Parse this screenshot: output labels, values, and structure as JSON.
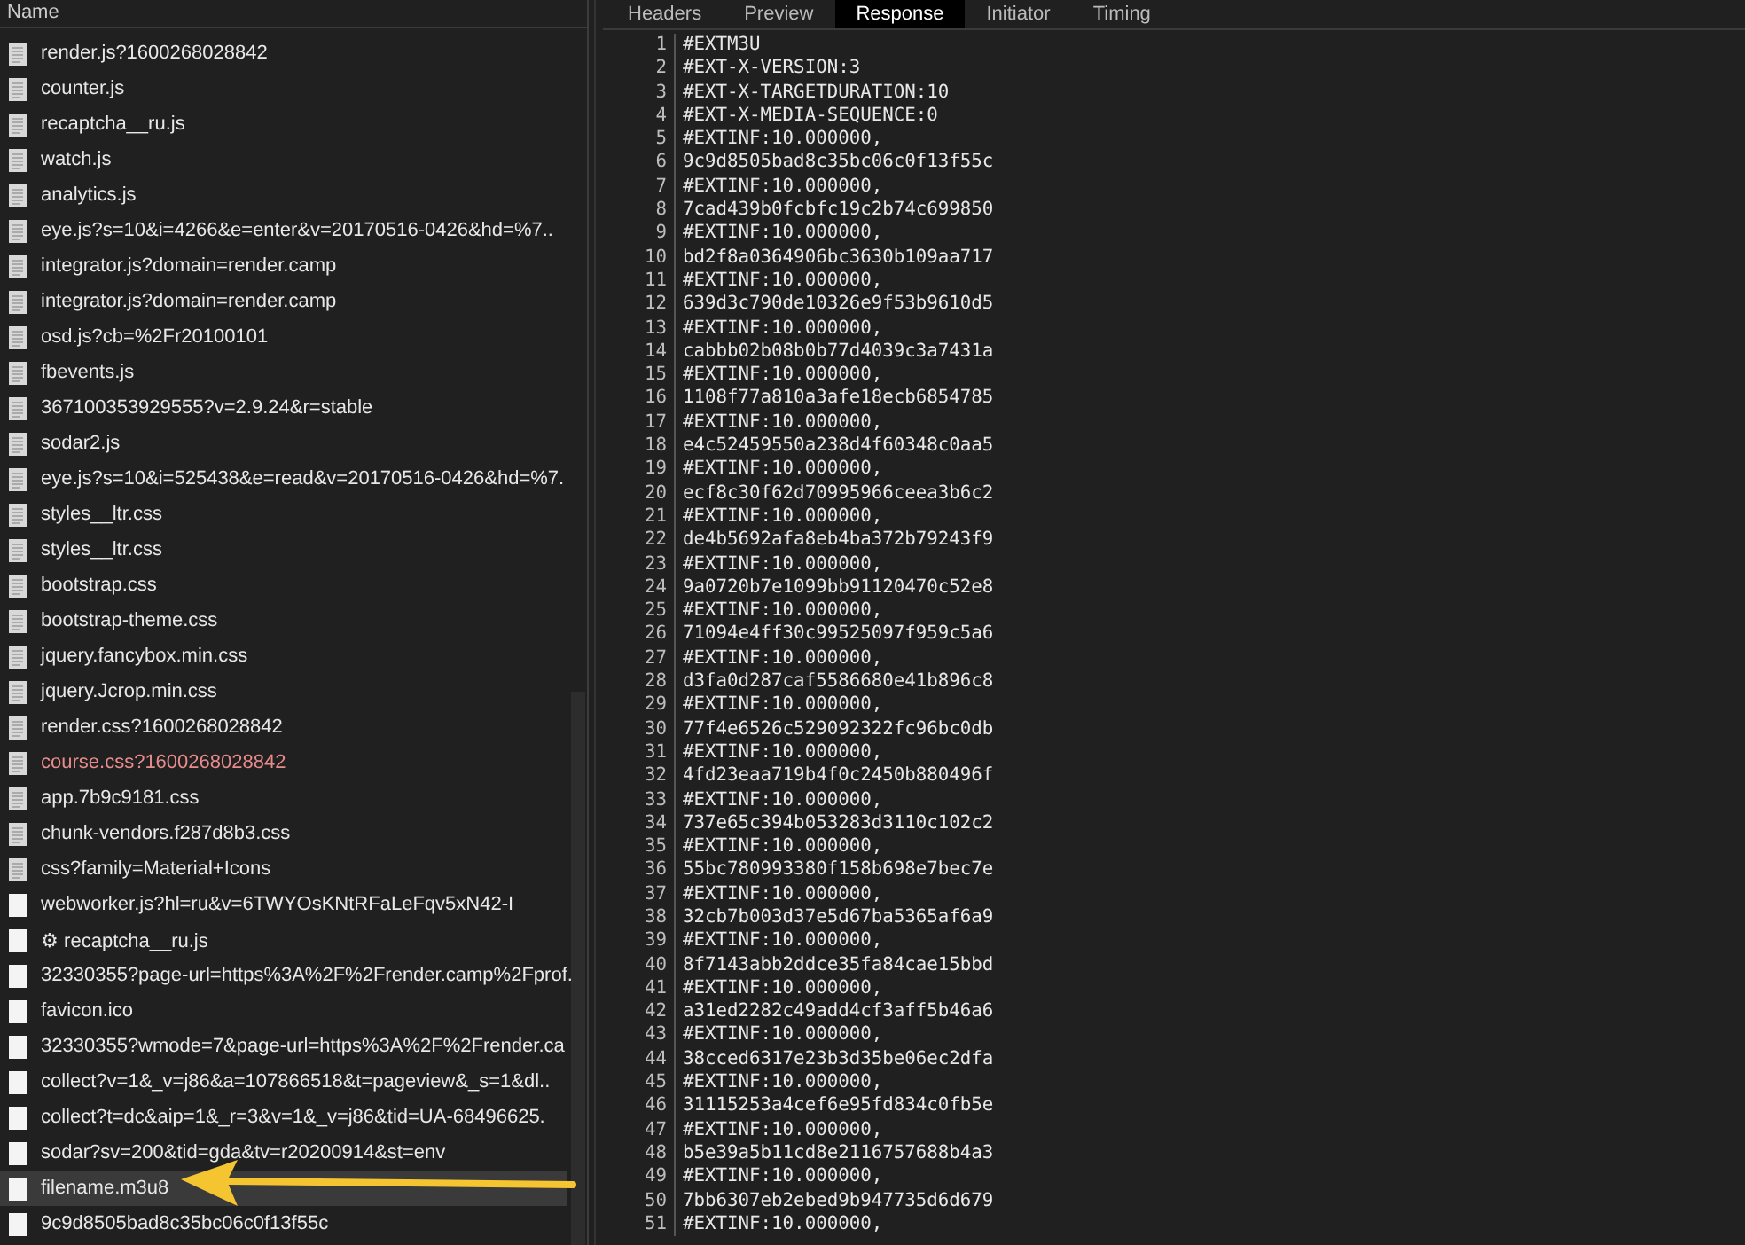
{
  "list_header": {
    "label": "Name"
  },
  "requests": [
    {
      "name": "render.js?1600268028842",
      "kind": "document",
      "error": false,
      "selected": false
    },
    {
      "name": "counter.js",
      "kind": "document",
      "error": false,
      "selected": false
    },
    {
      "name": "recaptcha__ru.js",
      "kind": "document",
      "error": false,
      "selected": false
    },
    {
      "name": "watch.js",
      "kind": "document",
      "error": false,
      "selected": false
    },
    {
      "name": "analytics.js",
      "kind": "document",
      "error": false,
      "selected": false
    },
    {
      "name": "eye.js?s=10&i=4266&e=enter&v=20170516-0426&hd=%7..",
      "kind": "document",
      "error": false,
      "selected": false
    },
    {
      "name": "integrator.js?domain=render.camp",
      "kind": "document",
      "error": false,
      "selected": false
    },
    {
      "name": "integrator.js?domain=render.camp",
      "kind": "document",
      "error": false,
      "selected": false
    },
    {
      "name": "osd.js?cb=%2Fr20100101",
      "kind": "document",
      "error": false,
      "selected": false
    },
    {
      "name": "fbevents.js",
      "kind": "document",
      "error": false,
      "selected": false
    },
    {
      "name": "367100353929555?v=2.9.24&r=stable",
      "kind": "document",
      "error": false,
      "selected": false
    },
    {
      "name": "sodar2.js",
      "kind": "document",
      "error": false,
      "selected": false
    },
    {
      "name": "eye.js?s=10&i=525438&e=read&v=20170516-0426&hd=%7.",
      "kind": "document",
      "error": false,
      "selected": false
    },
    {
      "name": "styles__ltr.css",
      "kind": "document",
      "error": false,
      "selected": false
    },
    {
      "name": "styles__ltr.css",
      "kind": "document",
      "error": false,
      "selected": false
    },
    {
      "name": "bootstrap.css",
      "kind": "document",
      "error": false,
      "selected": false
    },
    {
      "name": "bootstrap-theme.css",
      "kind": "document",
      "error": false,
      "selected": false
    },
    {
      "name": "jquery.fancybox.min.css",
      "kind": "document",
      "error": false,
      "selected": false
    },
    {
      "name": "jquery.Jcrop.min.css",
      "kind": "document",
      "error": false,
      "selected": false
    },
    {
      "name": "render.css?1600268028842",
      "kind": "document",
      "error": false,
      "selected": false
    },
    {
      "name": "course.css?1600268028842",
      "kind": "document",
      "error": true,
      "selected": false
    },
    {
      "name": "app.7b9c9181.css",
      "kind": "document",
      "error": false,
      "selected": false
    },
    {
      "name": "chunk-vendors.f287d8b3.css",
      "kind": "document",
      "error": false,
      "selected": false
    },
    {
      "name": "css?family=Material+Icons",
      "kind": "document",
      "error": false,
      "selected": false
    },
    {
      "name": "webworker.js?hl=ru&v=6TWYOsKNtRFaLeFqv5xN42-I",
      "kind": "blank",
      "error": false,
      "selected": false
    },
    {
      "name": "⚙ recaptcha__ru.js",
      "kind": "blank",
      "error": false,
      "selected": false
    },
    {
      "name": "32330355?page-url=https%3A%2F%2Frender.camp%2Fprof.",
      "kind": "blank",
      "error": false,
      "selected": false
    },
    {
      "name": "favicon.ico",
      "kind": "blank",
      "error": false,
      "selected": false
    },
    {
      "name": "32330355?wmode=7&page-url=https%3A%2F%2Frender.ca",
      "kind": "blank",
      "error": false,
      "selected": false
    },
    {
      "name": "collect?v=1&_v=j86&a=107866518&t=pageview&_s=1&dl..",
      "kind": "blank",
      "error": false,
      "selected": false
    },
    {
      "name": "collect?t=dc&aip=1&_r=3&v=1&_v=j86&tid=UA-68496625.",
      "kind": "blank",
      "error": false,
      "selected": false
    },
    {
      "name": "sodar?sv=200&tid=gda&tv=r20200914&st=env",
      "kind": "blank",
      "error": false,
      "selected": false
    },
    {
      "name": "filename.m3u8",
      "kind": "blank",
      "error": false,
      "selected": true
    },
    {
      "name": "9c9d8505bad8c35bc06c0f13f55c",
      "kind": "blank",
      "error": false,
      "selected": false
    }
  ],
  "tabs": [
    {
      "label": "Headers",
      "selected": false
    },
    {
      "label": "Preview",
      "selected": false
    },
    {
      "label": "Response",
      "selected": true
    },
    {
      "label": "Initiator",
      "selected": false
    },
    {
      "label": "Timing",
      "selected": false
    }
  ],
  "response_lines": [
    {
      "number": "1",
      "text": "#EXTM3U"
    },
    {
      "number": "2",
      "text": "#EXT-X-VERSION:3"
    },
    {
      "number": "3",
      "text": "#EXT-X-TARGETDURATION:10"
    },
    {
      "number": "4",
      "text": "#EXT-X-MEDIA-SEQUENCE:0"
    },
    {
      "number": "5",
      "text": "#EXTINF:10.000000,"
    },
    {
      "number": "6",
      "text": "9c9d8505bad8c35bc06c0f13f55c"
    },
    {
      "number": "7",
      "text": "#EXTINF:10.000000,"
    },
    {
      "number": "8",
      "text": "7cad439b0fcbfc19c2b74c699850"
    },
    {
      "number": "9",
      "text": "#EXTINF:10.000000,"
    },
    {
      "number": "10",
      "text": "bd2f8a0364906bc3630b109aa717"
    },
    {
      "number": "11",
      "text": "#EXTINF:10.000000,"
    },
    {
      "number": "12",
      "text": "639d3c790de10326e9f53b9610d5"
    },
    {
      "number": "13",
      "text": "#EXTINF:10.000000,"
    },
    {
      "number": "14",
      "text": "cabbb02b08b0b77d4039c3a7431a"
    },
    {
      "number": "15",
      "text": "#EXTINF:10.000000,"
    },
    {
      "number": "16",
      "text": "1108f77a810a3afe18ecb6854785"
    },
    {
      "number": "17",
      "text": "#EXTINF:10.000000,"
    },
    {
      "number": "18",
      "text": "e4c52459550a238d4f60348c0aa5"
    },
    {
      "number": "19",
      "text": "#EXTINF:10.000000,"
    },
    {
      "number": "20",
      "text": "ecf8c30f62d70995966ceea3b6c2"
    },
    {
      "number": "21",
      "text": "#EXTINF:10.000000,"
    },
    {
      "number": "22",
      "text": "de4b5692afa8eb4ba372b79243f9"
    },
    {
      "number": "23",
      "text": "#EXTINF:10.000000,"
    },
    {
      "number": "24",
      "text": "9a0720b7e1099bb91120470c52e8"
    },
    {
      "number": "25",
      "text": "#EXTINF:10.000000,"
    },
    {
      "number": "26",
      "text": "71094e4ff30c99525097f959c5a6"
    },
    {
      "number": "27",
      "text": "#EXTINF:10.000000,"
    },
    {
      "number": "28",
      "text": "d3fa0d287caf5586680e41b896c8"
    },
    {
      "number": "29",
      "text": "#EXTINF:10.000000,"
    },
    {
      "number": "30",
      "text": "77f4e6526c529092322fc96bc0db"
    },
    {
      "number": "31",
      "text": "#EXTINF:10.000000,"
    },
    {
      "number": "32",
      "text": "4fd23eaa719b4f0c2450b880496f"
    },
    {
      "number": "33",
      "text": "#EXTINF:10.000000,"
    },
    {
      "number": "34",
      "text": "737e65c394b053283d3110c102c2"
    },
    {
      "number": "35",
      "text": "#EXTINF:10.000000,"
    },
    {
      "number": "36",
      "text": "55bc780993380f158b698e7bec7e"
    },
    {
      "number": "37",
      "text": "#EXTINF:10.000000,"
    },
    {
      "number": "38",
      "text": "32cb7b003d37e5d67ba5365af6a9"
    },
    {
      "number": "39",
      "text": "#EXTINF:10.000000,"
    },
    {
      "number": "40",
      "text": "8f7143abb2ddce35fa84cae15bbd"
    },
    {
      "number": "41",
      "text": "#EXTINF:10.000000,"
    },
    {
      "number": "42",
      "text": "a31ed2282c49add4cf3aff5b46a6"
    },
    {
      "number": "43",
      "text": "#EXTINF:10.000000,"
    },
    {
      "number": "44",
      "text": "38cced6317e23b3d35be06ec2dfa"
    },
    {
      "number": "45",
      "text": "#EXTINF:10.000000,"
    },
    {
      "number": "46",
      "text": "31115253a4cef6e95fd834c0fb5e"
    },
    {
      "number": "47",
      "text": "#EXTINF:10.000000,"
    },
    {
      "number": "48",
      "text": "b5e39a5b11cd8e2116757688b4a3"
    },
    {
      "number": "49",
      "text": "#EXTINF:10.000000,"
    },
    {
      "number": "50",
      "text": "7bb6307eb2ebed9b947735d6d679"
    },
    {
      "number": "51",
      "text": "#EXTINF:10.000000,"
    }
  ]
}
